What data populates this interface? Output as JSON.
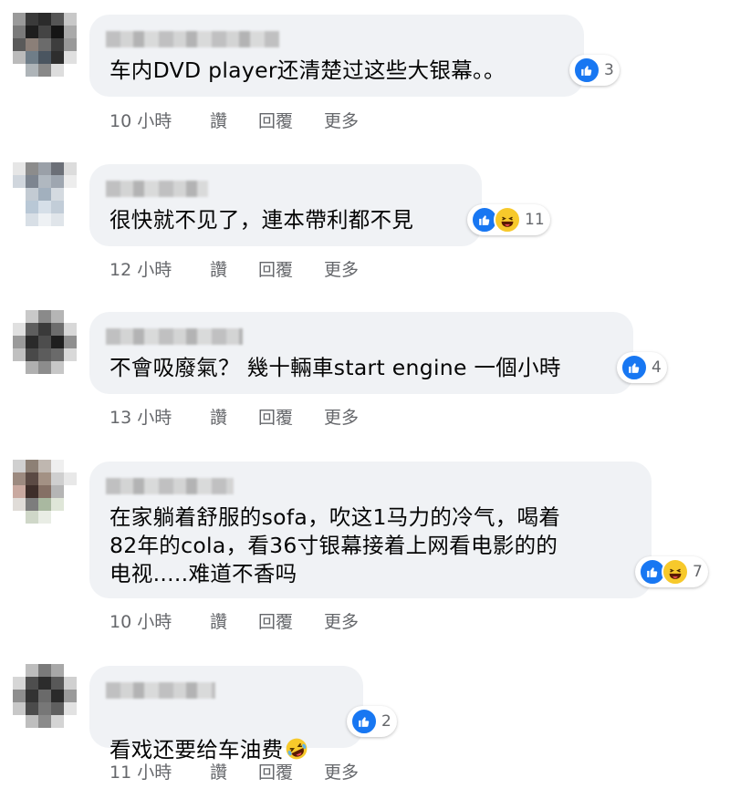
{
  "comments": [
    {
      "text": "车内DVD player还清楚过这些大银幕。。",
      "reactions": [
        "like-icon"
      ],
      "reaction_count": "3",
      "time": "10 小時",
      "actions": [
        "讚",
        "回覆",
        "更多"
      ]
    },
    {
      "text": "很快就不见了，連本帶利都不見",
      "reactions": [
        "like-icon",
        "haha-icon"
      ],
      "reaction_count": "11",
      "time": "12 小時",
      "actions": [
        "讚",
        "回覆",
        "更多"
      ]
    },
    {
      "text": "不會吸廢氣？ 幾十輛車start engine 一個小時",
      "reactions": [
        "like-icon"
      ],
      "reaction_count": "4",
      "time": "13 小時",
      "actions": [
        "讚",
        "回覆",
        "更多"
      ]
    },
    {
      "text": "在家躺着舒服的sofa，吹这1马力的冷气，喝着\n82年的cola，看36寸银幕接着上网看电影的的\n电视.....难道不香吗",
      "reactions": [
        "like-icon",
        "haha-icon"
      ],
      "reaction_count": "7",
      "time": "10 小時",
      "actions": [
        "讚",
        "回覆",
        "更多"
      ]
    },
    {
      "text": "看戏还要给车油费",
      "inline_emoji": "rolling-laughing-emoji",
      "reactions": [
        "like-icon"
      ],
      "reaction_count": "2",
      "time": "11 小時",
      "actions": [
        "讚",
        "回覆",
        "更多"
      ]
    }
  ],
  "colors": {
    "bubble": "#f0f2f5",
    "like": "#1877f2",
    "haha": "#f7c92b",
    "meta_text": "#65676b"
  }
}
